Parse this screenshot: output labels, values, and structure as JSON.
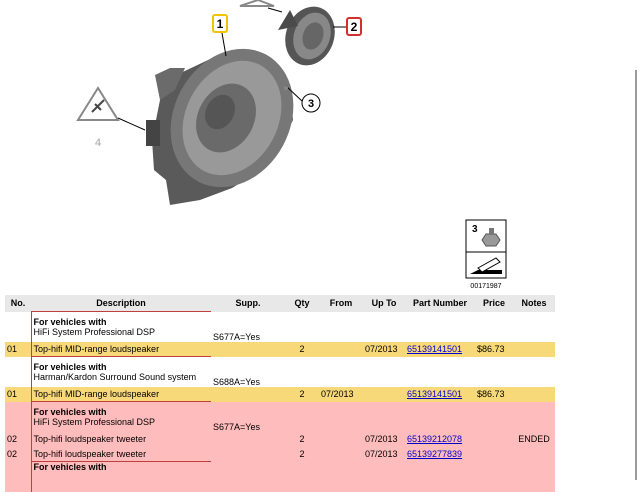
{
  "diagram": {
    "callouts": [
      "1",
      "2",
      "3",
      "4"
    ],
    "inset_callout": "3",
    "inset_image_id": "00171987",
    "icons": [
      "warning-triangle-icon",
      "speaker-midrange-image",
      "speaker-tweeter-image",
      "screw-nut-image",
      "wrench-icon"
    ]
  },
  "table": {
    "headers": [
      "No.",
      "Description",
      "Supp.",
      "Qty",
      "From",
      "Up To",
      "Part Number",
      "Price",
      "Notes"
    ],
    "rows": [
      {
        "type": "cond",
        "line1": "For vehicles with",
        "line2": "HiFi System Professional DSP",
        "supp": "S677A=Yes"
      },
      {
        "type": "part",
        "no": "01",
        "desc": "Top-hifi MID-range loudspeaker",
        "qty": "2",
        "from": "",
        "upto": "07/2013",
        "pn": "65139141501",
        "price": "$86.73",
        "notes": ""
      },
      {
        "type": "cond",
        "line1": "For vehicles with",
        "line2": "Harman/Kardon Surround Sound system",
        "supp": "S688A=Yes"
      },
      {
        "type": "part",
        "no": "01",
        "desc": "Top-hifi MID-range loudspeaker",
        "qty": "2",
        "from": "07/2013",
        "upto": "",
        "pn": "65139141501",
        "price": "$86.73",
        "notes": ""
      },
      {
        "type": "cond",
        "line1": "For vehicles with",
        "line2": "HiFi System Professional DSP",
        "supp": "S677A=Yes"
      },
      {
        "type": "part",
        "no": "02",
        "desc": "Top-hifi loudspeaker tweeter",
        "qty": "2",
        "from": "",
        "upto": "07/2013",
        "pn": "65139212078",
        "price": "",
        "notes": "ENDED"
      },
      {
        "type": "part",
        "no": "02",
        "desc": "Top-hifi loudspeaker tweeter",
        "qty": "2",
        "from": "",
        "upto": "07/2013",
        "pn": "65139277839",
        "price": "",
        "notes": ""
      },
      {
        "type": "cond",
        "line1": "For vehicles with",
        "line2": "",
        "supp": ""
      }
    ]
  },
  "colors": {
    "highlight_yellow": "#f7d97a",
    "highlight_pink": "#ffbcbc",
    "callout_yellow": "#f0c400",
    "callout_red": "#d03030"
  }
}
